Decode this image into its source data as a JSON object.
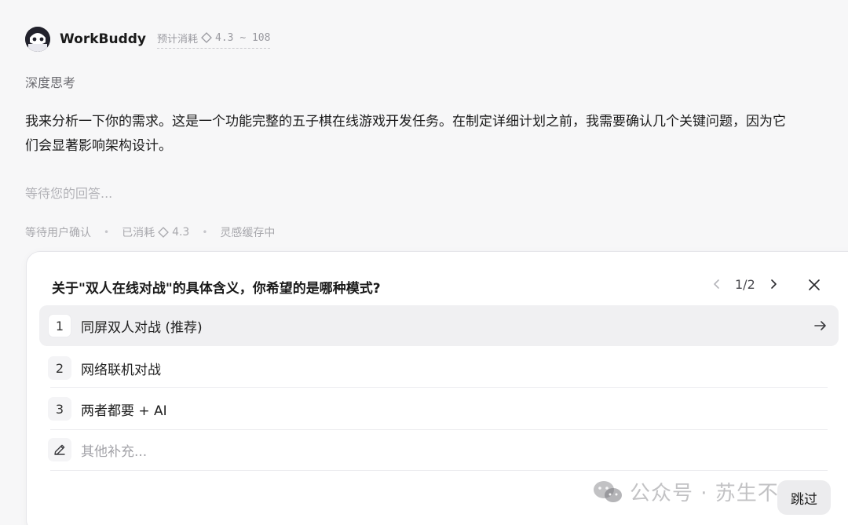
{
  "header": {
    "app_name": "WorkBuddy",
    "cost_label": "预计消耗",
    "cost_range": "4.3 ~ 108"
  },
  "thinking": {
    "label": "深度思考"
  },
  "message": {
    "line1": "我来分析一下你的需求。这是一个功能完整的五子棋在线游戏开发任务。在制定详细计划之前，我需要确认几个关键问题，因为它",
    "line2": "们会显著影响架构设计。"
  },
  "waiting_text": "等待您的回答...",
  "status": {
    "state": "等待用户确认",
    "spent_label": "已消耗",
    "spent_value": "4.3",
    "cache": "灵感缓存中"
  },
  "question": {
    "title": "关于\"双人在线对战\"的具体含义，你希望的是哪种模式?",
    "pager": "1/2",
    "options": [
      {
        "num": "1",
        "label": "同屏双人对战 (推荐)"
      },
      {
        "num": "2",
        "label": "网络联机对战"
      },
      {
        "num": "3",
        "label": "两者都要 + AI"
      }
    ],
    "other_placeholder": "其他补充..."
  },
  "watermark": "公众号 · 苏生不惑",
  "skip_label": "跳过",
  "colors": {
    "background": "#f7f7f8",
    "card": "#ffffff",
    "active_option": "#f0f0f2"
  }
}
